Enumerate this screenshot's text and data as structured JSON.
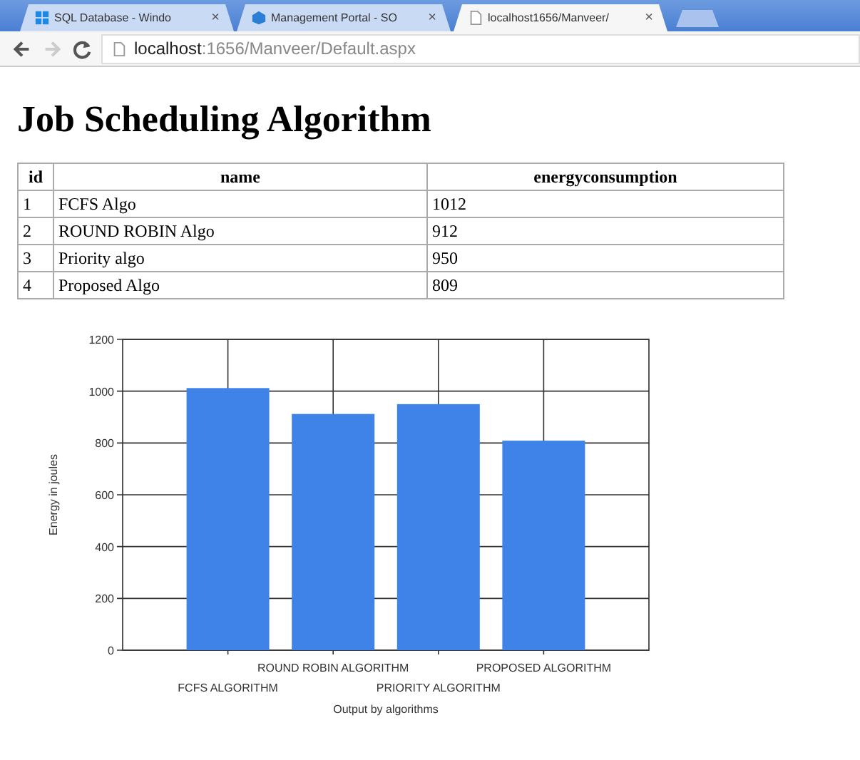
{
  "browser": {
    "tabs": [
      {
        "title": "SQL Database - Windo",
        "close": "×",
        "selected": false
      },
      {
        "title": "Management Portal - SO",
        "close": "×",
        "selected": false
      },
      {
        "title": "localhost1656/Manveer/",
        "close": "×",
        "selected": true
      }
    ],
    "url_host": "localhost",
    "url_rest": ":1656/Manveer/Default.aspx"
  },
  "page": {
    "heading": "Job Scheduling Algorithm",
    "table": {
      "columns": [
        "id",
        "name",
        "energyconsumption"
      ],
      "rows": [
        [
          "1",
          "FCFS Algo",
          "1012"
        ],
        [
          "2",
          "ROUND ROBIN Algo",
          "912"
        ],
        [
          "3",
          "Priority algo",
          "950"
        ],
        [
          "4",
          "Proposed Algo",
          "809"
        ]
      ]
    },
    "chart_data": {
      "type": "bar",
      "xlabel": "Output by algorithms",
      "ylabel": "Energy in joules",
      "categories": [
        "FCFS ALGORITHM",
        "ROUND ROBIN ALGORITHM",
        "PRIORITY ALGORITHM",
        "PROPOSED ALGORITHM"
      ],
      "values": [
        1012,
        912,
        950,
        809
      ],
      "ylim": [
        0,
        1200
      ],
      "yticks": [
        0,
        200,
        400,
        600,
        800,
        1000,
        1200
      ],
      "grid": true
    }
  }
}
